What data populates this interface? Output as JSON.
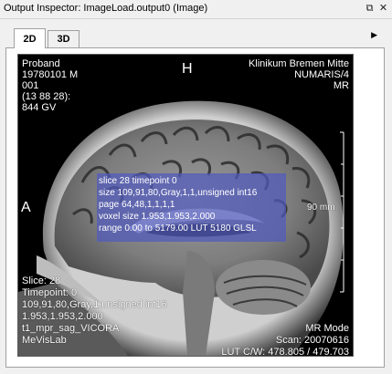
{
  "window": {
    "title": "Output Inspector: ImageLoad.output0 (Image)",
    "float_icon": "float-window-icon",
    "close_icon": "close-icon"
  },
  "tabs": [
    {
      "label": "2D",
      "active": true
    },
    {
      "label": "3D",
      "active": false
    }
  ],
  "tab_menu_icon": "arrow-right-icon",
  "viewer": {
    "top_left": [
      "Proband",
      "19780101  M",
      "001",
      "(13 88 28):",
      "844 GV"
    ],
    "orientation_top": "H",
    "orientation_left": "A",
    "top_right": [
      "Klinikum Bremen Mitte",
      "NUMARIS/4",
      "MR"
    ],
    "scale_label": "90 mm",
    "info": [
      "slice 28 timepoint 0",
      "size 109,91,80,Gray,1,1,unsigned int16",
      "page 64,48,1,1,1,1",
      "voxel size 1.953,1.953,2.000",
      "range 0.00 to 5179.00 LUT 5180 GLSL"
    ],
    "bottom_left": [
      "Slice: 28",
      "Timepoint: 0",
      "109,91,80,Gray,1,unsigned int16",
      "1.953,1.953,2.000",
      "t1_mpr_sag_VICORA",
      "MeVisLab"
    ],
    "bottom_right": [
      "MR Mode",
      "Scan: 20070616",
      "LUT C/W: 478.805 / 479.703"
    ],
    "info_box_color": "#505abe"
  }
}
